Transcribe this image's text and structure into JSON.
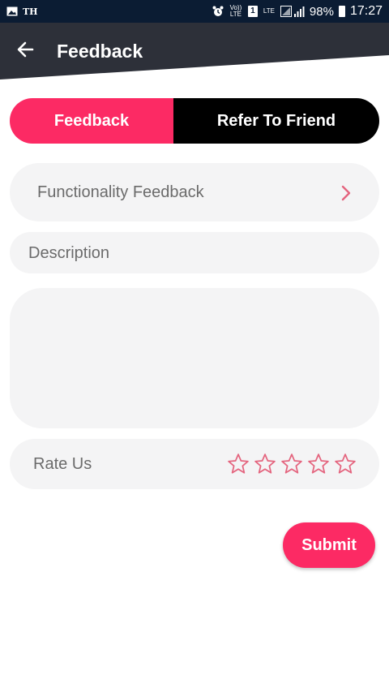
{
  "status_bar": {
    "carrier": "TH",
    "volte": "Vo)) LTE",
    "sim_slot": "1",
    "network": "LTE",
    "battery": "98%",
    "time": "17:27"
  },
  "header": {
    "title": "Feedback",
    "back_icon": "arrow-left-icon",
    "background_color": "#2d3039"
  },
  "tabs": [
    {
      "label": "Feedback",
      "active": true
    },
    {
      "label": "Refer To Friend",
      "active": false
    }
  ],
  "form": {
    "feedback_type": {
      "value": "Functionality Feedback",
      "icon": "chevron-right-icon"
    },
    "description_label": "Description",
    "description_value": "",
    "rating": {
      "label": "Rate Us",
      "value": 0,
      "max": 5
    },
    "submit_label": "Submit"
  },
  "colors": {
    "accent": "#fc2a64",
    "star": "#e4647e",
    "field_bg": "#f4f4f5",
    "status_bar": "#0b1c33"
  }
}
